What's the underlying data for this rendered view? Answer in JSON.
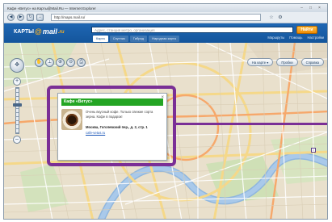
{
  "window": {
    "title": "Кафе «Ветус» на Карты@Mail.Ru — Internet Explorer"
  },
  "browser": {
    "address": "http://maps.mail.ru/"
  },
  "header": {
    "logo_text": "КАРТЫ",
    "logo_at": "@",
    "logo_mail": "mail",
    "logo_ru": ".ru",
    "search_placeholder": "Адрес, станция метро, организация",
    "search_button": "Найти",
    "tabs": [
      {
        "label": "Карта",
        "active": true
      },
      {
        "label": "Спутник",
        "active": false
      },
      {
        "label": "Гибрид",
        "active": false
      },
      {
        "label": "Народная карта",
        "active": false
      }
    ],
    "links": [
      "Маршруты",
      "Помощь",
      "Настройки"
    ]
  },
  "map": {
    "buttons": [
      "На карте",
      "Пробки",
      "Справка"
    ],
    "tools": [
      "ruler-icon",
      "hand-icon",
      "zoom-in-icon",
      "zoom-out-icon",
      "print-icon"
    ],
    "zoom_level_fraction": 0.37
  },
  "popup": {
    "title": "Кафе «Ветус»",
    "description": "Очень вкусный кофе. Только свежие сорта зерна. Кофе в подарок!",
    "address": "Москва, Гоголевский пер., д. 2, стр. 1",
    "link": "cafe-vetus.ru",
    "close": "×"
  },
  "colors": {
    "highlight": "#7a2f96",
    "header_blue": "#14559c",
    "popup_title_green": "#24a524",
    "search_button_orange": "#f08a00"
  }
}
